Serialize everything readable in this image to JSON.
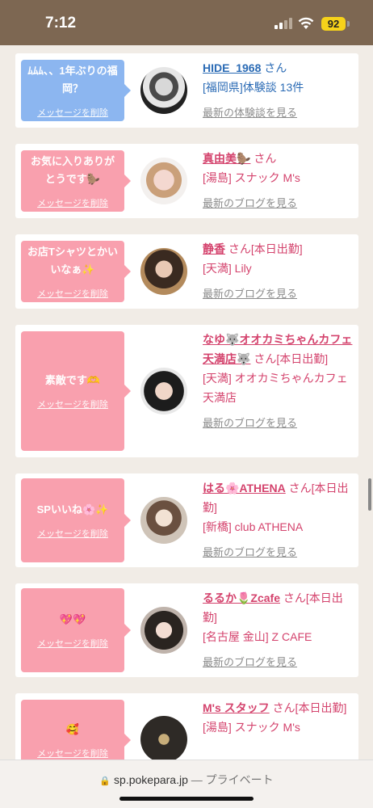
{
  "status": {
    "time": "7:12",
    "battery": "92"
  },
  "delete_label": "メッセージを削除",
  "items": [
    {
      "message": "ﾑﾑﾑ、、1年ぶりの福岡？",
      "name": "HIDE_1968",
      "suffix": "さん",
      "sub": "[福岡県]体験談 13件",
      "link": "最新の体験談を見る"
    },
    {
      "message": "お気に入りありがとうです🦫",
      "name": "真由美🦫",
      "suffix": "さん",
      "sub": "[湯島] スナック M's",
      "link": "最新のブログを見る"
    },
    {
      "message": "お店Tシャツとかいいなぁ✨",
      "name": "静香",
      "suffix": "さん[本日出勤]",
      "sub": "[天満] Lily",
      "link": "最新のブログを見る"
    },
    {
      "message": "素敵です🫶",
      "name": "なゆ🐺オオカミちゃんカフェ天満店🐺",
      "suffix": "さん[本日出勤]",
      "sub": "[天満] オオカミちゃんカフェ天満店",
      "link": "最新のブログを見る"
    },
    {
      "message": "SPいいね🌸✨",
      "name": "はる🌸ATHENA",
      "suffix": "さん[本日出勤]",
      "sub": "[新橋] club ATHENA",
      "link": "最新のブログを見る"
    },
    {
      "message": "💖💖",
      "name": "るるか🌷Zcafe",
      "suffix": "さん[本日出勤]",
      "sub": "[名古屋 金山] Z CAFE",
      "link": "最新のブログを見る"
    },
    {
      "message": "🥰",
      "name": "M's スタッフ",
      "suffix": "さん[本日出勤]",
      "sub": "[湯島] スナック M's",
      "link": ""
    }
  ],
  "browser": {
    "url": "sp.pokepara.jp",
    "mode": "— プライベート"
  },
  "colors": {
    "status_bar": "#7d6752",
    "pink": "#f9a0ae",
    "blue": "#8cb6f0",
    "name_pink": "#d4436d",
    "name_blue": "#2b6bb5"
  }
}
